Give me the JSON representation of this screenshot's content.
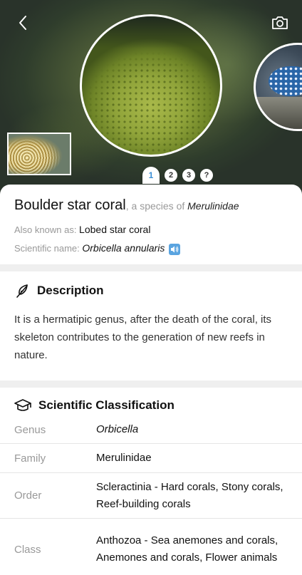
{
  "species": {
    "common_name": "Boulder star coral",
    "species_prefix": ", a species of ",
    "family_name": "Merulinidae"
  },
  "meta": {
    "aka_label": "Also known as: ",
    "aka_value": "Lobed star coral",
    "sci_label": "Scientific name: ",
    "sci_value": "Orbicella annularis"
  },
  "gallery": {
    "pages": [
      "1",
      "2",
      "3",
      "?"
    ],
    "active_page": "1"
  },
  "description": {
    "title": "Description",
    "text": "It is a hermatipic genus, after the death of the coral, its skeleton contributes to the generation of new reefs in nature."
  },
  "classification": {
    "title": "Scientific Classification",
    "rows": [
      {
        "key": "Genus",
        "value": "Orbicella"
      },
      {
        "key": "Family",
        "value": "Merulinidae"
      },
      {
        "key": "Order",
        "value": "Scleractinia - Hard corals, Stony corals, Reef-building corals"
      },
      {
        "key": "Class",
        "value": "Anthozoa - Sea anemones and corals, Anemones and corals, Flower animals"
      }
    ]
  },
  "icons": {
    "back": "chevron-left-icon",
    "camera": "camera-icon",
    "speaker": "speaker-icon",
    "feather": "feather-icon",
    "graduation": "graduation-cap-icon"
  },
  "colors": {
    "accent": "#3a8fd6",
    "speaker_bg": "#5aa4e0",
    "muted": "#999999",
    "divider": "#efefef"
  }
}
